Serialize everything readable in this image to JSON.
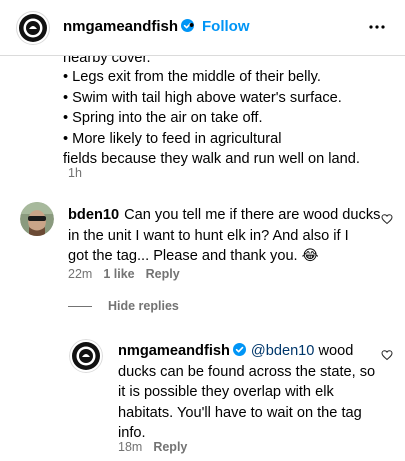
{
  "header": {
    "username": "nmgameandfish",
    "separator": "•",
    "follow_label": "Follow",
    "avatar_text": "NEW MEXICO GAME & FISH"
  },
  "caption": {
    "clipped_line": "nearby cover.",
    "lines": [
      "• Legs exit from the middle of their belly.",
      "• Swim with tail high above water's surface.",
      "• Spring into the air on take off.",
      "• More likely to feed in agricultural",
      "fields because they walk and run well on land."
    ],
    "time": "1h"
  },
  "comment": {
    "username": "bden10",
    "lines": [
      "Can you tell me if there are wood ducks",
      "in the unit I want to hunt elk in? And also if I",
      "got the tag... Please and thank you. 😂"
    ],
    "time": "22m",
    "likes": "1 like",
    "reply_label": "Reply"
  },
  "hide_replies_label": "Hide replies",
  "reply": {
    "username": "nmgameandfish",
    "mention": "@bden10",
    "first_line_rest": " wood",
    "lines": [
      "ducks can be found across the state, so",
      "it is possible they overlap with elk",
      "habitats. You'll have to wait on the tag",
      "info."
    ],
    "time": "18m",
    "reply_label": "Reply"
  },
  "colors": {
    "follow_blue": "#0095f6",
    "verified_blue": "#0095f6",
    "secondary_text": "#737373",
    "mention": "#00376b"
  },
  "icons": {
    "more": "more-horizontal-icon",
    "like": "heart-outline-icon",
    "verified": "verified-badge-icon"
  }
}
